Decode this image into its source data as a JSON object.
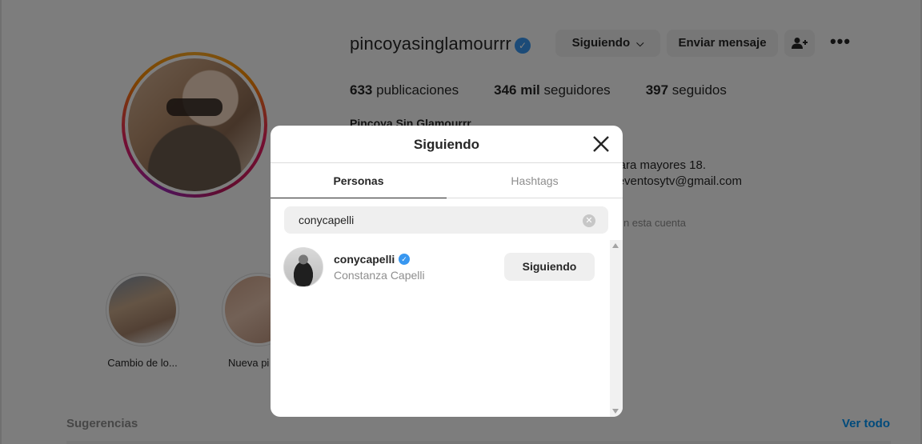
{
  "profile": {
    "username": "pincoyasinglamourrr",
    "verified_icon": "verified-badge-icon",
    "following_button": "Siguiendo",
    "following_chevron": "⌵",
    "message_button": "Enviar mensaje",
    "add_user_icon": "add-user-icon",
    "more_icon": "more-icon",
    "stats": {
      "posts_count": "633",
      "posts_label": "publicaciones",
      "followers_count": "346 mil",
      "followers_label": "seguidores",
      "following_count": "397",
      "following_label": "seguidos"
    },
    "full_name": "Pincoya Sin Glamourrr",
    "bio_line_1": "ara mayores 18.",
    "bio_line_2": "eventosytv@gmail.com",
    "followed_by": "n esta cuenta"
  },
  "highlights": [
    {
      "label": "Cambio de lo..."
    },
    {
      "label": "Nueva pi"
    }
  ],
  "suggestions": {
    "title": "Sugerencias",
    "see_all": "Ver todo"
  },
  "modal": {
    "title": "Siguiendo",
    "close_icon": "✕",
    "tabs": [
      {
        "label": "Personas",
        "active": true
      },
      {
        "label": "Hashtags",
        "active": false
      }
    ],
    "search": {
      "value": "conycapelli",
      "clear_icon": "✕"
    },
    "results": [
      {
        "username": "conycapelli",
        "verified": true,
        "full_name": "Constanza Capelli",
        "button": "Siguiendo"
      }
    ]
  },
  "colors": {
    "accent_blue": "#0095f6",
    "verified_blue": "#3897f0",
    "text_primary": "#262626",
    "text_secondary": "#8e8e8e",
    "button_bg": "#efefef"
  }
}
